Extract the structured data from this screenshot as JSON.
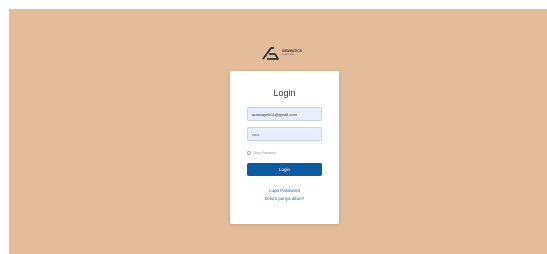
{
  "brand": {
    "name": "GEOMATICS",
    "tagline": "PLATFORM",
    "icon": "geomatics-logo"
  },
  "login": {
    "title": "Login",
    "email_value": "aulanayek01@gmail.com",
    "password_value": "•••••",
    "show_password_label": "Show Password",
    "show_password_checked": false,
    "button_label": "Login",
    "forgot_link": "Lupa Password",
    "register_link": "belum punya akun?"
  },
  "colors": {
    "page_background": "#e3bc99",
    "card_background": "#ffffff",
    "primary_button": "#0e5a9e",
    "link": "#1f5fa8",
    "input_fill": "#e8eefc"
  }
}
